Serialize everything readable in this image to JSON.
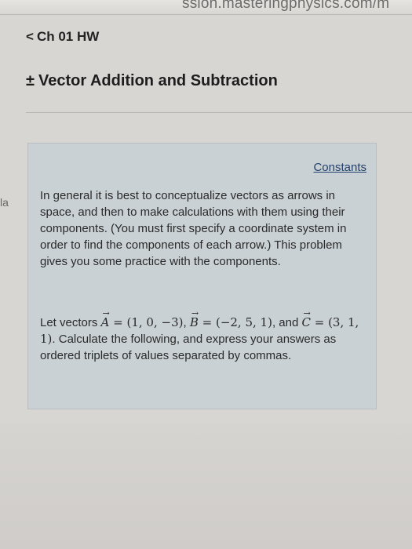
{
  "browser": {
    "url_fragment": "ssion.masteringphysics.com/m"
  },
  "nav": {
    "back_label": "Ch 01 HW",
    "chevron_glyph": "<"
  },
  "page": {
    "title_prefix": "±",
    "title": "Vector Addition and Subtraction"
  },
  "side_fragment": "la",
  "panel": {
    "constants_link": "Constants",
    "intro": "In general it is best to conceptualize vectors as arrows in space, and then to make calculations with them using their components. (You must first specify a coordinate system in order to find the components of each arrow.) This problem gives you some practice with the components.",
    "problem": {
      "lead": "Let vectors ",
      "vecA": "A",
      "eqA": " = (1, 0, −3)",
      "sep1": ", ",
      "vecB": "B",
      "eqB": " = (−2, 5, 1)",
      "sep2": ", and ",
      "vecC": "C",
      "eqC": " = (3, 1, 1)",
      "tail": ". Calculate the following, and express your answers as ordered triplets of values separated by commas."
    }
  }
}
